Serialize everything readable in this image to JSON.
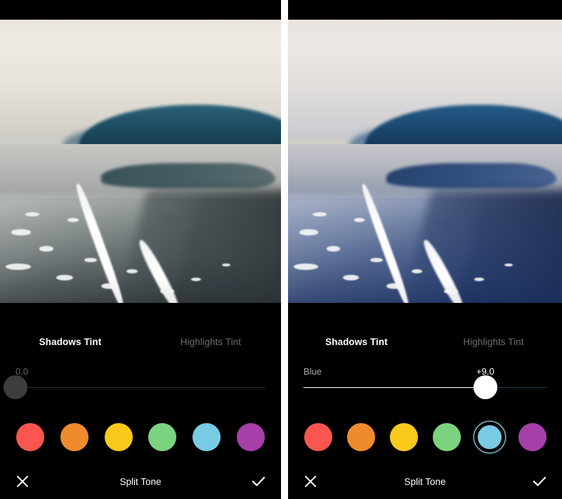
{
  "app": {
    "editor_name": "Split Tone",
    "background": "#000000"
  },
  "panels": [
    {
      "id": "before",
      "photo": {
        "alt": "Beach at low tide with foam line, distant headland and pale overcast sky",
        "tint_state": "untinted"
      },
      "tabs": [
        {
          "label": "Shadows Tint",
          "active": true
        },
        {
          "label": "Highlights Tint",
          "active": false
        }
      ],
      "slider": {
        "label": "",
        "value_text": "0.0",
        "percent": 0,
        "knob_color": "#3d3d3d",
        "fill_color": "#ffffff",
        "rest_color": "#2a2a2a",
        "label_dim": true
      },
      "swatches": [
        {
          "name": "red",
          "color": "#f9564f",
          "selected": false
        },
        {
          "name": "orange",
          "color": "#ef8b2c",
          "selected": false
        },
        {
          "name": "yellow",
          "color": "#fbc91b",
          "selected": false
        },
        {
          "name": "green",
          "color": "#7bd37f",
          "selected": false
        },
        {
          "name": "blue",
          "color": "#79cbe3",
          "selected": false
        },
        {
          "name": "purple",
          "color": "#a63fa8",
          "selected": false
        }
      ],
      "actions": {
        "cancel": "✕",
        "title": "Split Tone",
        "confirm": "✓"
      }
    },
    {
      "id": "after",
      "photo": {
        "alt": "Same beach scene with blue shadow tint applied",
        "tint_state": "blue-tinted"
      },
      "tabs": [
        {
          "label": "Shadows Tint",
          "active": true
        },
        {
          "label": "Highlights Tint",
          "active": false
        }
      ],
      "slider": {
        "label": "Blue",
        "value_text": "+9.0",
        "percent": 72,
        "knob_color": "#ffffff",
        "fill_color": "#ffffff",
        "rest_color": "#1d4450",
        "label_dim": false
      },
      "swatches": [
        {
          "name": "red",
          "color": "#f9564f",
          "selected": false
        },
        {
          "name": "orange",
          "color": "#ef8b2c",
          "selected": false
        },
        {
          "name": "yellow",
          "color": "#fbc91b",
          "selected": false
        },
        {
          "name": "green",
          "color": "#7bd37f",
          "selected": false
        },
        {
          "name": "blue",
          "color": "#79cbe3",
          "selected": true
        },
        {
          "name": "purple",
          "color": "#a63fa8",
          "selected": false
        }
      ],
      "actions": {
        "cancel": "✕",
        "title": "Split Tone",
        "confirm": "✓"
      }
    }
  ]
}
